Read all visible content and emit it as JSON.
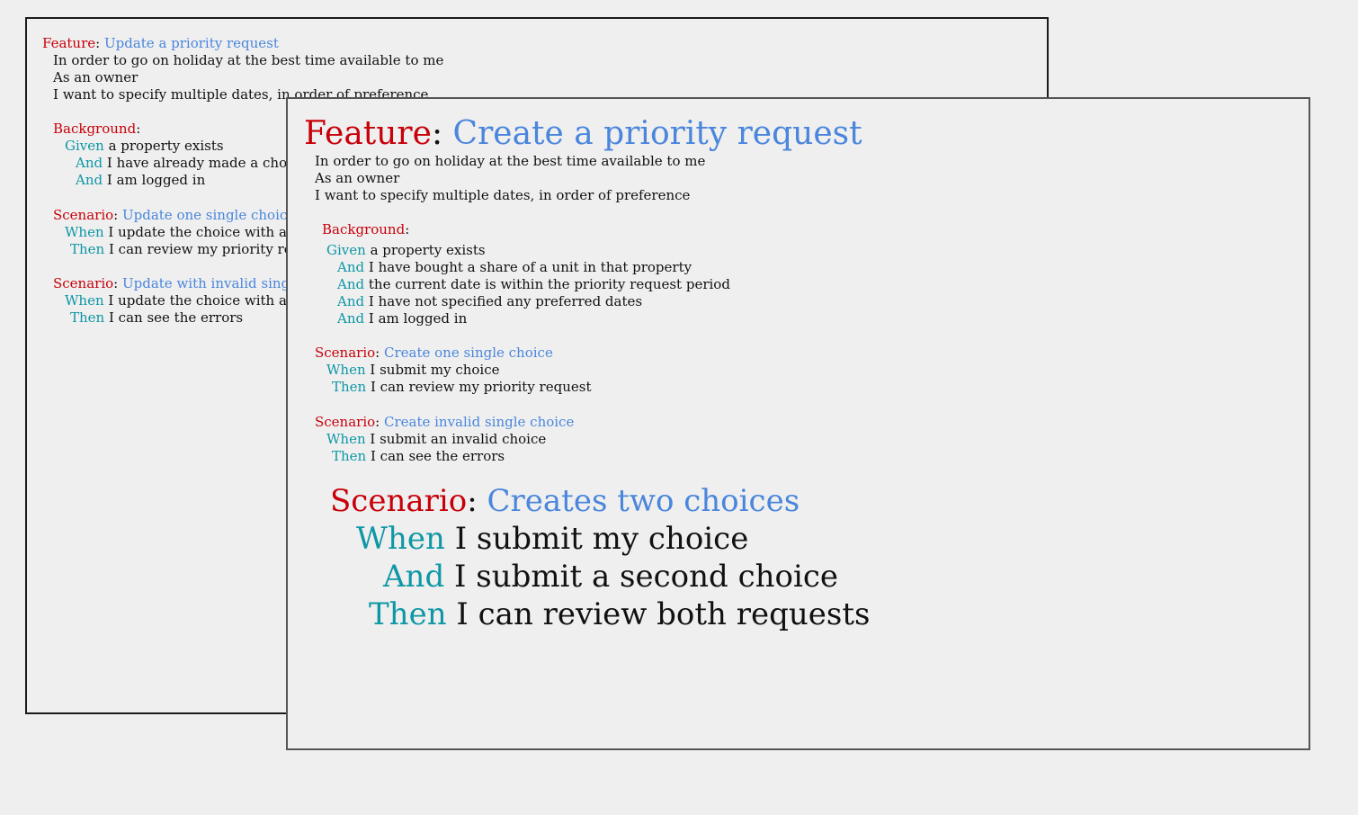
{
  "back": {
    "feature": {
      "keyword": "Feature",
      "title": "Update a priority request"
    },
    "description": [
      "In order to go on holiday at the best time available to me",
      "As an owner",
      "I want to specify multiple dates, in order of preference"
    ],
    "background": {
      "keyword": "Background",
      "steps": [
        {
          "keyword": "Given",
          "text": "a property exists"
        },
        {
          "keyword": "And",
          "text": "I have already made a choice"
        },
        {
          "keyword": "And",
          "text": "I am logged in"
        }
      ]
    },
    "scenario1": {
      "keyword": "Scenario",
      "title": "Update one single choice",
      "steps": [
        {
          "keyword": "When",
          "text": "I update the choice with a valid date"
        },
        {
          "keyword": "Then",
          "text": "I can review my priority request"
        }
      ]
    },
    "scenario2": {
      "keyword": "Scenario",
      "title": "Update with invalid single choice",
      "steps": [
        {
          "keyword": "When",
          "text": "I update the choice with an invalid date"
        },
        {
          "keyword": "Then",
          "text": "I can see the errors"
        }
      ]
    }
  },
  "front": {
    "feature": {
      "keyword": "Feature",
      "title": "Create a priority request"
    },
    "description": [
      "In order to go on holiday at the best time available to me",
      "As an owner",
      "I want to specify multiple dates, in order of preference"
    ],
    "background": {
      "keyword": "Background",
      "steps": [
        {
          "keyword": "Given",
          "text": "a property exists"
        },
        {
          "keyword": "And",
          "text": "I have bought a share of a unit in that property"
        },
        {
          "keyword": "And",
          "text": "the current date is within the priority request period"
        },
        {
          "keyword": "And",
          "text": "I have not specified any preferred dates"
        },
        {
          "keyword": "And",
          "text": "I am logged in"
        }
      ]
    },
    "scenario1": {
      "keyword": "Scenario",
      "title": "Create one single choice",
      "steps": [
        {
          "keyword": "When",
          "text": "I submit my choice"
        },
        {
          "keyword": "Then",
          "text": "I can review my priority request"
        }
      ]
    },
    "scenario2": {
      "keyword": "Scenario",
      "title": "Create invalid single choice",
      "steps": [
        {
          "keyword": "When",
          "text": "I submit an invalid choice"
        },
        {
          "keyword": "Then",
          "text": "I can see the errors"
        }
      ]
    },
    "scenario3": {
      "keyword": "Scenario",
      "title": "Creates two choices",
      "steps": [
        {
          "keyword": "When",
          "text": "I submit my choice"
        },
        {
          "keyword": "And",
          "text": "I submit a second choice"
        },
        {
          "keyword": "Then",
          "text": "I can review both requests"
        }
      ]
    }
  },
  "colors": {
    "keyword_red": "#c8000a",
    "keyword_teal": "#0e97a5",
    "title_blue": "#4a86dc"
  }
}
